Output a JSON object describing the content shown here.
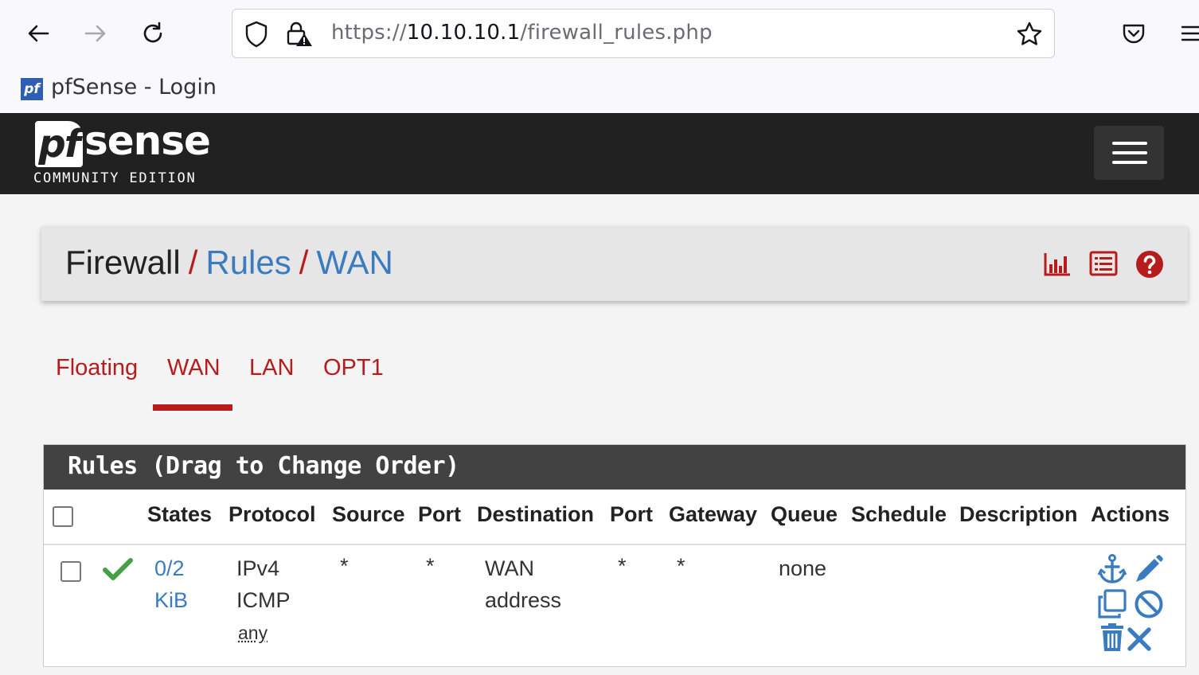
{
  "browser": {
    "url_scheme": "https://",
    "url_host": "10.10.10.1",
    "url_path": "/firewall_rules.php",
    "tab_title": "pfSense - Login",
    "favicon_text": "pf"
  },
  "navbar": {
    "logo_pf": "pf",
    "logo_sense": "sense",
    "logo_edition": "COMMUNITY EDITION"
  },
  "breadcrumb": {
    "items": [
      "Firewall",
      "Rules",
      "WAN"
    ],
    "separator": "/"
  },
  "tabs": [
    {
      "label": "Floating",
      "active": false
    },
    {
      "label": "WAN",
      "active": true
    },
    {
      "label": "LAN",
      "active": false
    },
    {
      "label": "OPT1",
      "active": false
    }
  ],
  "rules": {
    "title": "Rules (Drag to Change Order)",
    "columns": [
      "States",
      "Protocol",
      "Source",
      "Port",
      "Destination",
      "Port",
      "Gateway",
      "Queue",
      "Schedule",
      "Description",
      "Actions"
    ],
    "rows": [
      {
        "states_line1": "0/2",
        "states_line2": "KiB",
        "protocol_line1": "IPv4",
        "protocol_line2": "ICMP",
        "protocol_line3": "any",
        "source": "*",
        "source_port": "*",
        "destination_line1": "WAN",
        "destination_line2": "address",
        "dest_port": "*",
        "gateway": "*",
        "queue": "none",
        "schedule": "",
        "description": ""
      }
    ]
  },
  "colors": {
    "accent_red": "#b71c1c",
    "link_blue": "#3b7bbf",
    "navbar_bg": "#212121",
    "check_green": "#43a047"
  }
}
